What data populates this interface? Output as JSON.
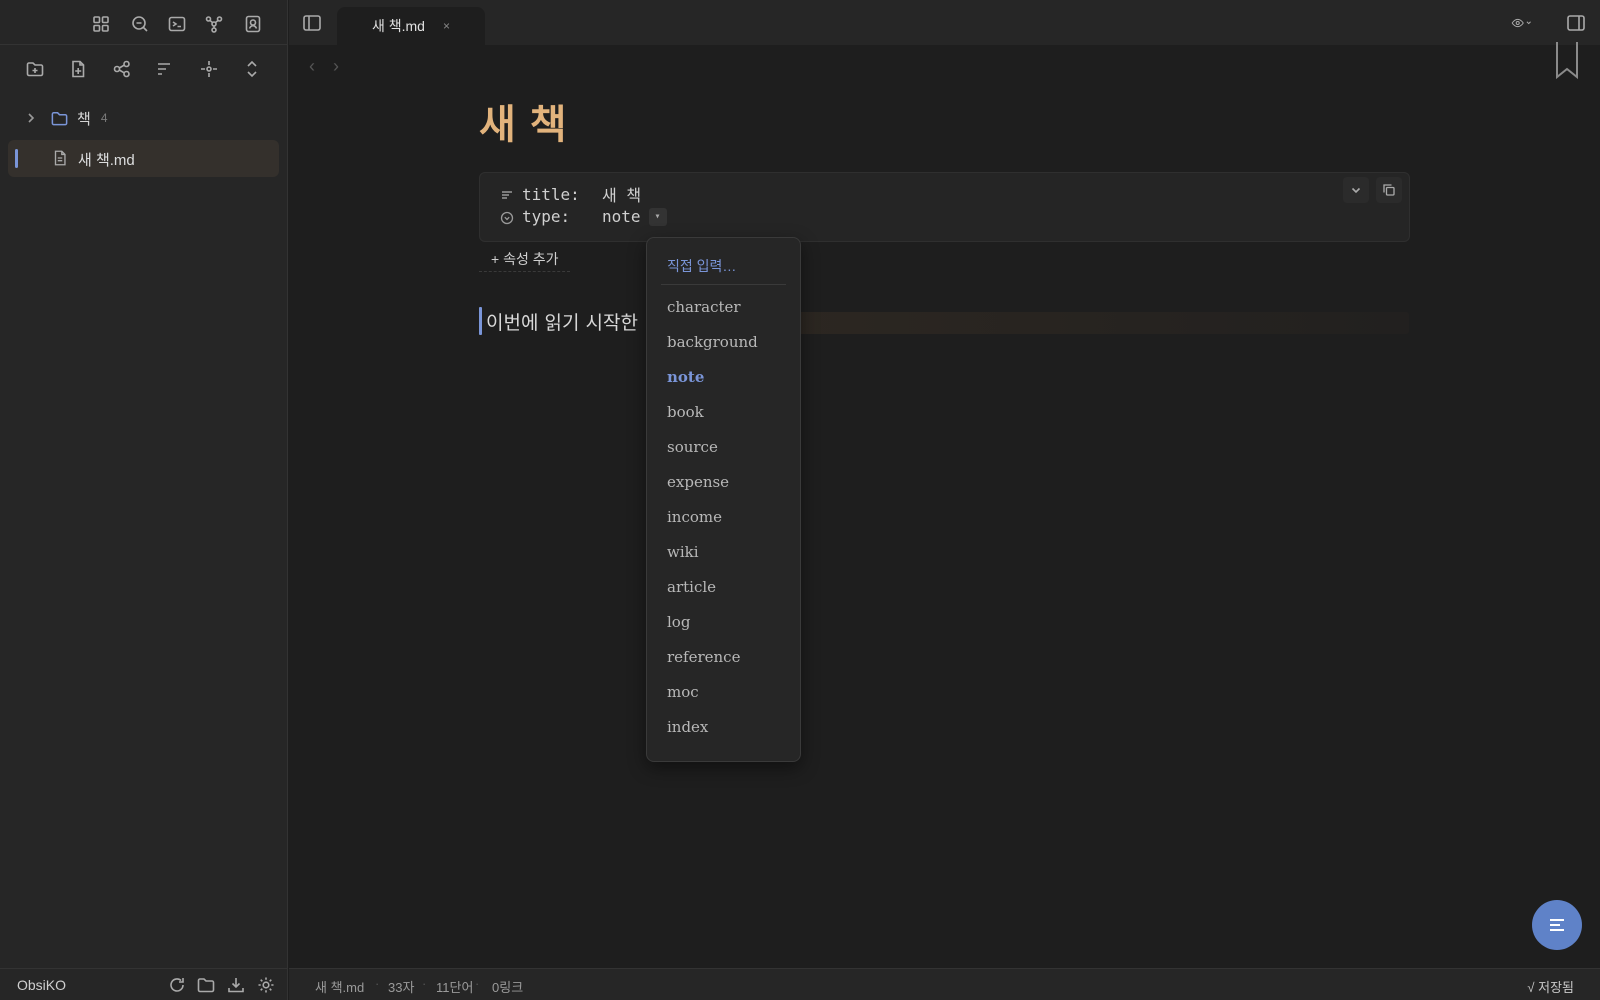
{
  "sidebar": {
    "ribbon_icons": [
      "grid-icon",
      "search-zoom-icon",
      "terminal-icon",
      "graph-icon",
      "contact-icon"
    ],
    "nav_icons": [
      "new-folder-icon",
      "new-note-icon",
      "graph-view-icon",
      "sort-icon",
      "focus-icon",
      "collapse-icon"
    ],
    "folder": {
      "name": "책",
      "count": "4"
    },
    "file": {
      "name": "새 책.md"
    },
    "vault_name": "ObsiKO"
  },
  "tab": {
    "title": "새 책.md",
    "close": "×"
  },
  "editor": {
    "title": "새 책",
    "properties": [
      {
        "key": "title:",
        "value": "새 책",
        "icon": "text-lines-icon"
      },
      {
        "key": "type:",
        "value": "note",
        "icon": "circle-chevron-icon"
      }
    ],
    "add_property": "+ 속성 추가",
    "body_text": "이번에 읽기 시작한"
  },
  "dropdown": {
    "custom_input": "직접 입력…",
    "options": [
      "character",
      "background",
      "note",
      "book",
      "source",
      "expense",
      "income",
      "wiki",
      "article",
      "log",
      "reference",
      "moc",
      "index"
    ],
    "selected": "note"
  },
  "status": {
    "file": "새 책.md",
    "chars": "33자",
    "words": "11단어",
    "links": "0링크",
    "saved": "√ 저장됨"
  },
  "colors": {
    "accent": "#7a95d8",
    "title": "#e2b37c",
    "fab": "#5f82c8"
  }
}
